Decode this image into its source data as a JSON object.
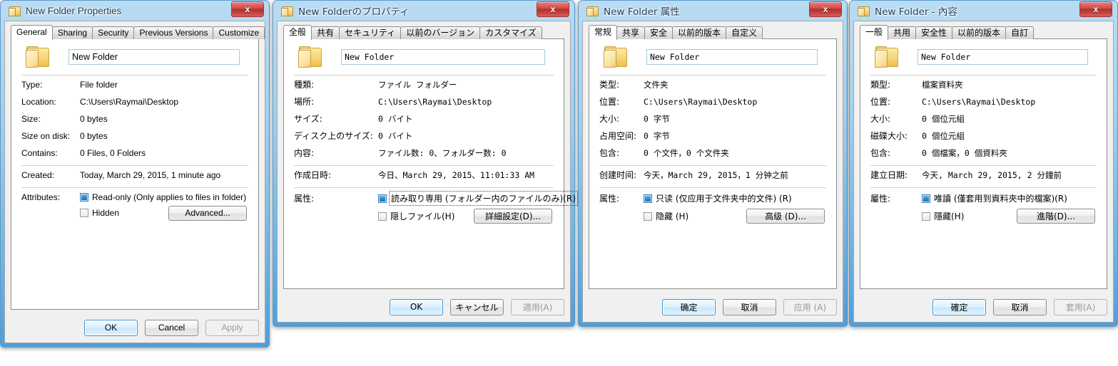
{
  "desktop": {
    "background": "#ffffff"
  },
  "dialogs": [
    {
      "lang": "en",
      "title": "New Folder Properties",
      "close_label": "x",
      "tabs": [
        "General",
        "Sharing",
        "Security",
        "Previous Versions",
        "Customize"
      ],
      "selected_tab": "General",
      "name_value": "New Folder",
      "rows": [
        {
          "label": "Type:",
          "value": "File folder"
        },
        {
          "label": "Location:",
          "value": "C:\\Users\\Raymai\\Desktop"
        },
        {
          "label": "Size:",
          "value": "0 bytes"
        },
        {
          "label": "Size on disk:",
          "value": "0 bytes"
        },
        {
          "label": "Contains:",
          "value": "0 Files, 0 Folders"
        }
      ],
      "created_label": "Created:",
      "created_value": "Today, March 29, 2015, 1 minute ago",
      "attributes_label": "Attributes:",
      "readonly_label": "Read-only (Only applies to files in folder)",
      "readonly_checked": "filled",
      "readonly_focused": false,
      "hidden_label": "Hidden",
      "hidden_checked": "unchecked",
      "advanced_label": "Advanced...",
      "ok_label": "OK",
      "cancel_label": "Cancel",
      "apply_label": "Apply"
    },
    {
      "lang": "ja",
      "title": "New Folderのプロパティ",
      "close_label": "x",
      "tabs": [
        "全般",
        "共有",
        "セキュリティ",
        "以前のバージョン",
        "カスタマイズ"
      ],
      "selected_tab": "全般",
      "name_value": "New Folder",
      "rows": [
        {
          "label": "種類:",
          "value": "ファイル フォルダー"
        },
        {
          "label": "場所:",
          "value": "C:\\Users\\Raymai\\Desktop"
        },
        {
          "label": "サイズ:",
          "value": "0 バイト"
        },
        {
          "label": "ディスク上のサイズ:",
          "value": "0 バイト"
        },
        {
          "label": "内容:",
          "value": "ファイル数: 0、フォルダー数: 0"
        }
      ],
      "created_label": "作成日時:",
      "created_value": "今日、March 29, 2015、11:01:33 AM",
      "attributes_label": "属性:",
      "readonly_label": "読み取り専用 (フォルダー内のファイルのみ)(R)",
      "readonly_checked": "filled",
      "readonly_focused": true,
      "hidden_label": "隠しファイル(H)",
      "hidden_checked": "unchecked",
      "advanced_label": "詳細設定(D)...",
      "ok_label": "OK",
      "cancel_label": "キャンセル",
      "apply_label": "適用(A)"
    },
    {
      "lang": "zh-CN",
      "title": "New Folder 属性",
      "close_label": "x",
      "tabs": [
        "常规",
        "共享",
        "安全",
        "以前的版本",
        "自定义"
      ],
      "selected_tab": "常规",
      "name_value": "New Folder",
      "rows": [
        {
          "label": "类型:",
          "value": "文件夹"
        },
        {
          "label": "位置:",
          "value": "C:\\Users\\Raymai\\Desktop"
        },
        {
          "label": "大小:",
          "value": "0 字节"
        },
        {
          "label": "占用空间:",
          "value": "0 字节"
        },
        {
          "label": "包含:",
          "value": "0 个文件，0 个文件夹"
        }
      ],
      "created_label": "创建时间:",
      "created_value": "今天，March 29, 2015，1 分钟之前",
      "attributes_label": "属性:",
      "readonly_label": "只读 (仅应用于文件夹中的文件) (R)",
      "readonly_checked": "filled",
      "readonly_focused": false,
      "hidden_label": "隐藏 (H)",
      "hidden_checked": "unchecked",
      "advanced_label": "高级 (D)...",
      "ok_label": "确定",
      "cancel_label": "取消",
      "apply_label": "应用 (A)"
    },
    {
      "lang": "zh-TW",
      "title": "New Folder - 內容",
      "close_label": "x",
      "tabs": [
        "一般",
        "共用",
        "安全性",
        "以前的版本",
        "自訂"
      ],
      "selected_tab": "一般",
      "name_value": "New Folder",
      "rows": [
        {
          "label": "類型:",
          "value": "檔案資料夾"
        },
        {
          "label": "位置:",
          "value": "C:\\Users\\Raymai\\Desktop"
        },
        {
          "label": "大小:",
          "value": "0 個位元組"
        },
        {
          "label": "磁碟大小:",
          "value": "0 個位元組"
        },
        {
          "label": "包含:",
          "value": "0 個檔案，0 個資料夾"
        }
      ],
      "created_label": "建立日期:",
      "created_value": "今天, March 29, 2015, 2 分鐘前",
      "attributes_label": "屬性:",
      "readonly_label": "唯讀 (僅套用到資料夾中的檔案)(R)",
      "readonly_checked": "filled",
      "readonly_focused": false,
      "hidden_label": "隱藏(H)",
      "hidden_checked": "unchecked",
      "advanced_label": "進階(D)...",
      "ok_label": "確定",
      "cancel_label": "取消",
      "apply_label": "套用(A)"
    }
  ]
}
